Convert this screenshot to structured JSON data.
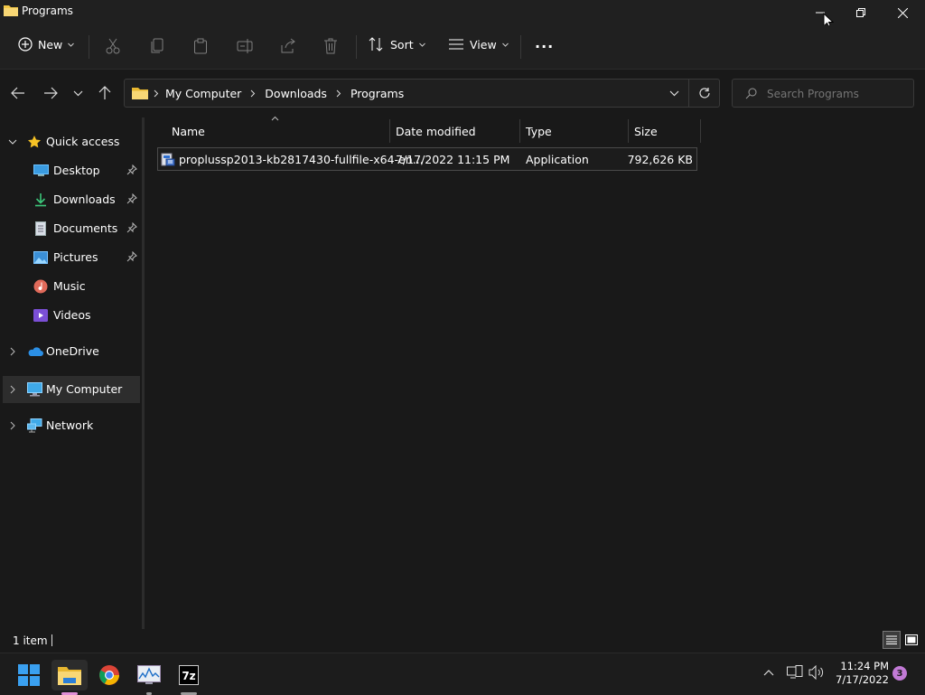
{
  "window": {
    "title": "Programs"
  },
  "toolbar": {
    "new_label": "New",
    "sort_label": "Sort",
    "view_label": "View",
    "more_label": "···"
  },
  "address": {
    "crumbs": [
      "My Computer",
      "Downloads",
      "Programs"
    ]
  },
  "search": {
    "placeholder": "Search Programs"
  },
  "nav": {
    "quick_access": "Quick access",
    "items": [
      {
        "label": "Desktop"
      },
      {
        "label": "Downloads"
      },
      {
        "label": "Documents"
      },
      {
        "label": "Pictures"
      },
      {
        "label": "Music"
      },
      {
        "label": "Videos"
      }
    ],
    "onedrive": "OneDrive",
    "my_computer": "My Computer",
    "network": "Network"
  },
  "columns": {
    "name": "Name",
    "date": "Date modified",
    "type": "Type",
    "size": "Size"
  },
  "files": [
    {
      "name": "proplussp2013-kb2817430-fullfile-x64-en...",
      "date": "7/17/2022 11:15 PM",
      "type": "Application",
      "size": "792,626 KB"
    }
  ],
  "status": {
    "count": "1 item"
  },
  "taskbar": {
    "time": "11:24 PM",
    "date": "7/17/2022",
    "notifications": "3"
  },
  "colors": {
    "accent": "#0078d4",
    "folder": "#f3c846",
    "star": "#f7c325"
  }
}
